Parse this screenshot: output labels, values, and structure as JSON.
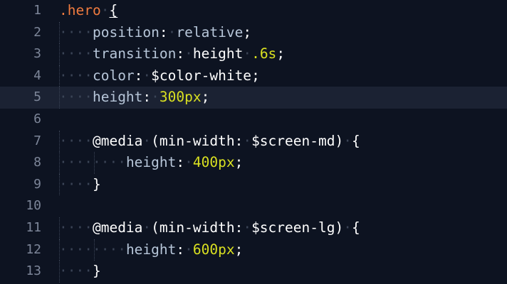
{
  "editor": {
    "colors": {
      "background": "#0d1321",
      "active_line": "#1b2233",
      "selector": "#f07b3f",
      "property": "#b7c6d9",
      "number": "#d9e021",
      "text": "#ffffff",
      "gutter": "#7d8699"
    },
    "active_line": 5,
    "lines": [
      {
        "num": "1",
        "indent": 0,
        "tokens": [
          {
            "c": "sel",
            "t": ".hero"
          },
          {
            "c": "dot",
            "t": "·"
          },
          {
            "c": "punct underline",
            "t": "{"
          }
        ]
      },
      {
        "num": "2",
        "indent": 1,
        "tokens": [
          {
            "c": "prop",
            "t": "position"
          },
          {
            "c": "punct",
            "t": ":"
          },
          {
            "c": "dot",
            "t": "·"
          },
          {
            "c": "prop",
            "t": "relative"
          },
          {
            "c": "punct",
            "t": ";"
          }
        ]
      },
      {
        "num": "3",
        "indent": 1,
        "tokens": [
          {
            "c": "prop",
            "t": "transition"
          },
          {
            "c": "punct",
            "t": ":"
          },
          {
            "c": "dot",
            "t": "·"
          },
          {
            "c": "val",
            "t": "height"
          },
          {
            "c": "dot",
            "t": "·"
          },
          {
            "c": "num",
            "t": ".6s"
          },
          {
            "c": "punct",
            "t": ";"
          }
        ]
      },
      {
        "num": "4",
        "indent": 1,
        "tokens": [
          {
            "c": "prop",
            "t": "color"
          },
          {
            "c": "punct",
            "t": ":"
          },
          {
            "c": "dot",
            "t": "·"
          },
          {
            "c": "var",
            "t": "$color-white"
          },
          {
            "c": "punct",
            "t": ";"
          }
        ]
      },
      {
        "num": "5",
        "indent": 1,
        "tokens": [
          {
            "c": "prop",
            "t": "height"
          },
          {
            "c": "punct",
            "t": ":"
          },
          {
            "c": "dot",
            "t": "·"
          },
          {
            "c": "num",
            "t": "300px"
          },
          {
            "c": "punct",
            "t": ";"
          }
        ]
      },
      {
        "num": "6",
        "indent": 0,
        "tokens": []
      },
      {
        "num": "7",
        "indent": 1,
        "tokens": [
          {
            "c": "at",
            "t": "@media"
          },
          {
            "c": "dot",
            "t": "·"
          },
          {
            "c": "val",
            "t": "(min-width:"
          },
          {
            "c": "dot",
            "t": "·"
          },
          {
            "c": "var",
            "t": "$screen-md)"
          },
          {
            "c": "dot",
            "t": "·"
          },
          {
            "c": "punct",
            "t": "{"
          }
        ]
      },
      {
        "num": "8",
        "indent": 2,
        "tokens": [
          {
            "c": "prop",
            "t": "height"
          },
          {
            "c": "punct",
            "t": ":"
          },
          {
            "c": "dot",
            "t": "·"
          },
          {
            "c": "num",
            "t": "400px"
          },
          {
            "c": "punct",
            "t": ";"
          }
        ]
      },
      {
        "num": "9",
        "indent": 1,
        "tokens": [
          {
            "c": "punct",
            "t": "}"
          }
        ]
      },
      {
        "num": "10",
        "indent": 0,
        "tokens": []
      },
      {
        "num": "11",
        "indent": 1,
        "tokens": [
          {
            "c": "at",
            "t": "@media"
          },
          {
            "c": "dot",
            "t": "·"
          },
          {
            "c": "val",
            "t": "(min-width:"
          },
          {
            "c": "dot",
            "t": "·"
          },
          {
            "c": "var",
            "t": "$screen-lg)"
          },
          {
            "c": "dot",
            "t": "·"
          },
          {
            "c": "punct",
            "t": "{"
          }
        ]
      },
      {
        "num": "12",
        "indent": 2,
        "tokens": [
          {
            "c": "prop",
            "t": "height"
          },
          {
            "c": "punct",
            "t": ":"
          },
          {
            "c": "dot",
            "t": "·"
          },
          {
            "c": "num",
            "t": "600px"
          },
          {
            "c": "punct",
            "t": ";"
          }
        ]
      },
      {
        "num": "13",
        "indent": 1,
        "tokens": [
          {
            "c": "punct",
            "t": "}"
          }
        ]
      }
    ]
  }
}
